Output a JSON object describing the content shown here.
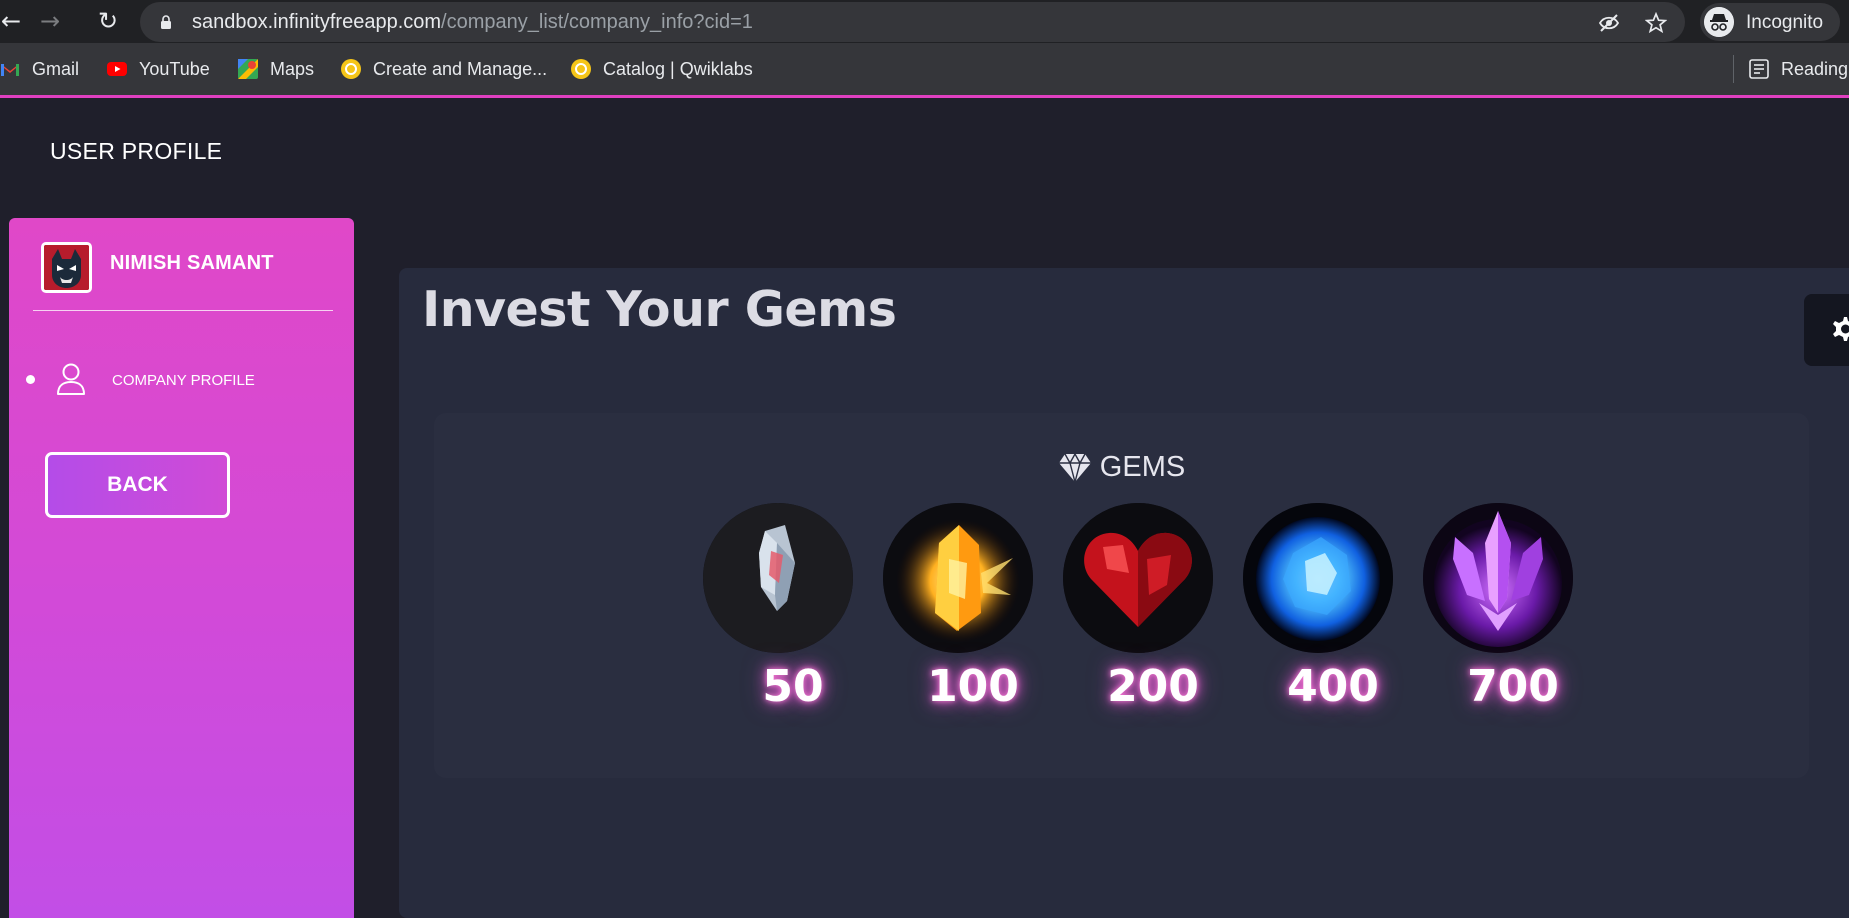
{
  "browser": {
    "url_host": "sandbox.infinityfreeapp.com",
    "url_path": "/company_list/company_info?cid=1",
    "profile_label": "Incognito",
    "bookmarks": [
      {
        "label": "Gmail",
        "icon": "gmail-icon"
      },
      {
        "label": "YouTube",
        "icon": "youtube-icon"
      },
      {
        "label": "Maps",
        "icon": "maps-icon"
      },
      {
        "label": "Create and Manage...",
        "icon": "qwiklabs-icon"
      },
      {
        "label": "Catalog | Qwiklabs",
        "icon": "qwiklabs-icon"
      }
    ],
    "reading_list_label": "Reading"
  },
  "page": {
    "title": "USER PROFILE"
  },
  "sidebar": {
    "user_name": "NIMISH SAMANT",
    "nav_items": [
      {
        "label": "COMPANY PROFILE",
        "icon": "user-icon"
      }
    ],
    "back_label": "BACK"
  },
  "main": {
    "heading": "Invest Your Gems",
    "gems_title": "GEMS",
    "gems": [
      {
        "value": "50",
        "kind": "crystal-shard"
      },
      {
        "value": "100",
        "kind": "amber-crystal"
      },
      {
        "value": "200",
        "kind": "ruby-heart"
      },
      {
        "value": "400",
        "kind": "blue-orb"
      },
      {
        "value": "700",
        "kind": "amethyst-cluster"
      }
    ]
  },
  "colors": {
    "accent_pink": "#e048c8",
    "sidebar_bottom": "#c24ee6",
    "page_bg": "#1f1f2b",
    "card_bg": "#272b3d",
    "glow": "#ff7ad9"
  }
}
